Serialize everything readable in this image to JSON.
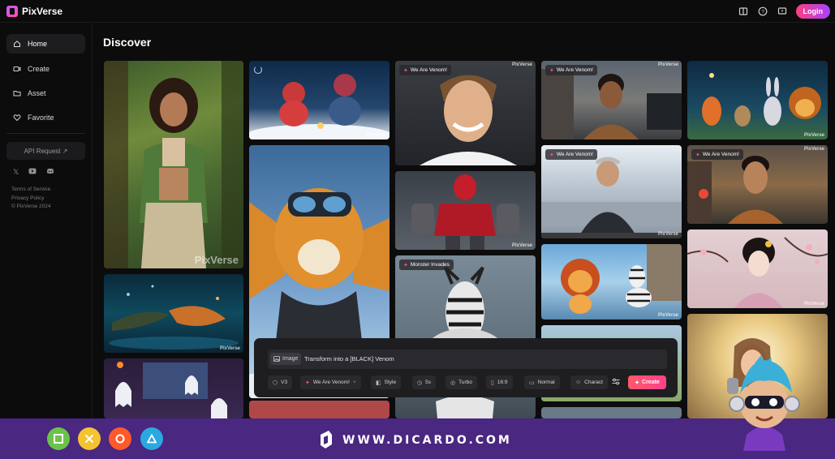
{
  "app": {
    "name": "PixVerse",
    "login_label": "Login"
  },
  "topbar_icons": [
    "book-icon",
    "help-icon",
    "feedback-icon"
  ],
  "sidebar": {
    "items": [
      {
        "label": "Home",
        "icon": "home-icon",
        "active": true
      },
      {
        "label": "Create",
        "icon": "create-icon",
        "active": false
      },
      {
        "label": "Asset",
        "icon": "folder-icon",
        "active": false
      },
      {
        "label": "Favorite",
        "icon": "heart-icon",
        "active": false
      }
    ],
    "api_label": "API Request ↗",
    "socials": [
      "x-icon",
      "youtube-icon",
      "discord-icon"
    ],
    "footer": {
      "terms": "Terms of Service",
      "privacy": "Privacy Policy",
      "copyright": "© PixVerse 2024"
    }
  },
  "main": {
    "title": "Discover"
  },
  "cards": {
    "c2_badge": "We Are Venom!",
    "c3_badge": "We Are Venom!",
    "c3b_badge": "We Are Venom!",
    "c4_badge": "We Are Venom!",
    "c2c_badge": "Monster Invades",
    "watermark": "PixVerse",
    "watermark_big": "PixVerse"
  },
  "prompt": {
    "image_chip": "Image",
    "text": "Transform into a [BLACK] Venom",
    "chips": {
      "model": "V3",
      "effect": "We Are Venom!",
      "effect_close": "×",
      "style": "Style",
      "duration": "5s",
      "speed": "Turbo",
      "ratio": "16:9",
      "motion": "Normal",
      "character": "Charact"
    },
    "create_label": "Create"
  },
  "banner": {
    "url": "WWW.DICARDO.COM",
    "buttons": [
      "square-icon",
      "cross-icon",
      "circle-icon",
      "triangle-icon"
    ]
  },
  "colors": {
    "accent": "#ff3f8c",
    "banner": "#4a2780",
    "background": "#0c0c0d"
  }
}
